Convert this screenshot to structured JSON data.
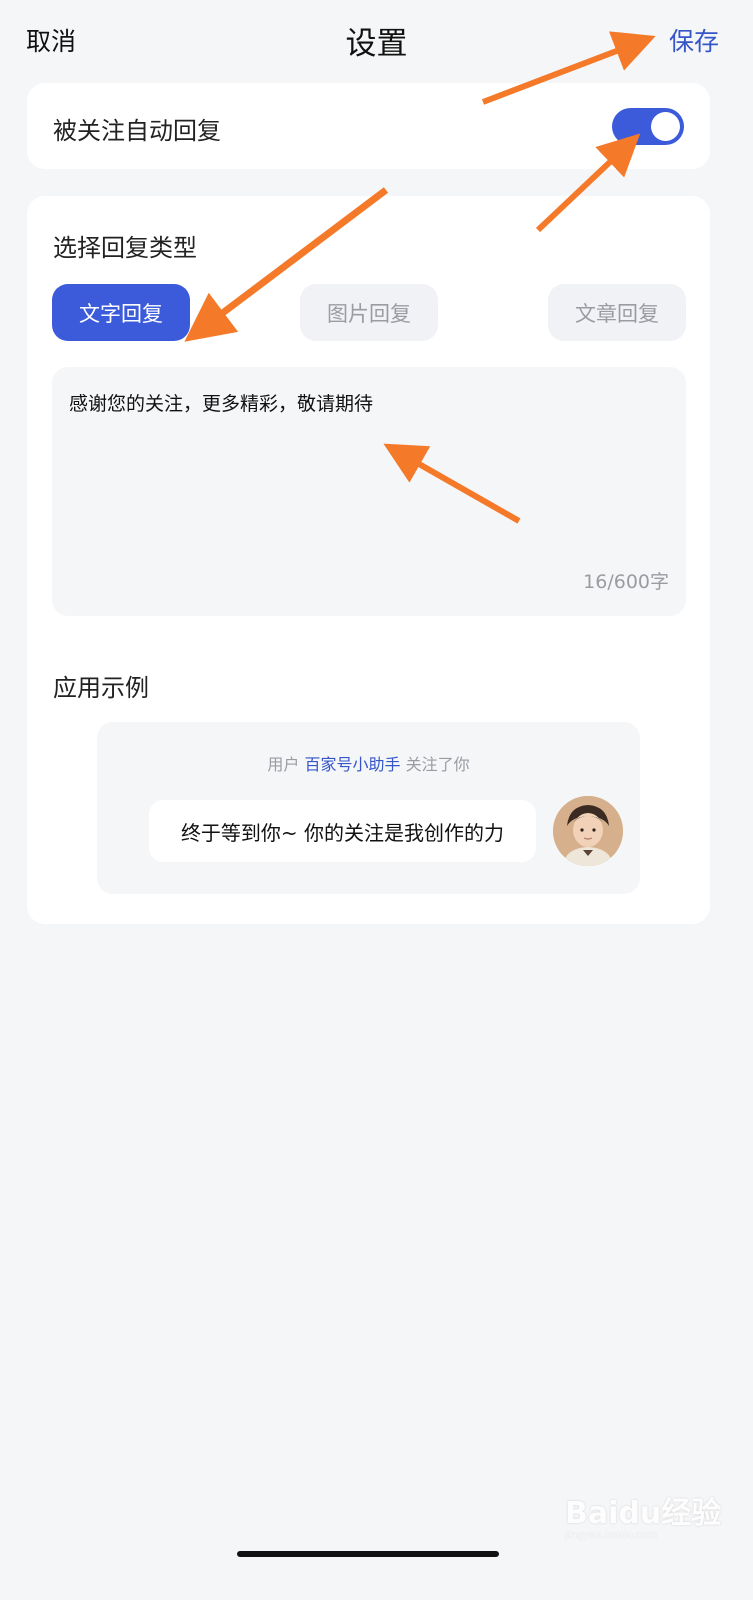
{
  "header": {
    "cancel_label": "取消",
    "title": "设置",
    "save_label": "保存"
  },
  "auto_reply": {
    "label": "被关注自动回复",
    "enabled": true
  },
  "reply_type": {
    "section_title": "选择回复类型",
    "options": [
      {
        "label": "文字回复",
        "selected": true
      },
      {
        "label": "图片回复",
        "selected": false
      },
      {
        "label": "文章回复",
        "selected": false
      }
    ]
  },
  "message": {
    "content": "感谢您的关注，更多精彩，敬请期待",
    "counter": "16/600字"
  },
  "example": {
    "section_title": "应用示例",
    "notice_prefix": "用户",
    "notice_name": "百家号小助手",
    "notice_suffix": "关注了你",
    "bubble_text": "终于等到你~ 你的关注是我创作的力"
  },
  "watermark": {
    "brand": "Baidu经验",
    "url": "jingyan.baidu.com"
  },
  "colors": {
    "accent": "#3b5bdb",
    "link": "#3556c9",
    "arrow": "#f47a2a",
    "background": "#f5f6f8"
  }
}
